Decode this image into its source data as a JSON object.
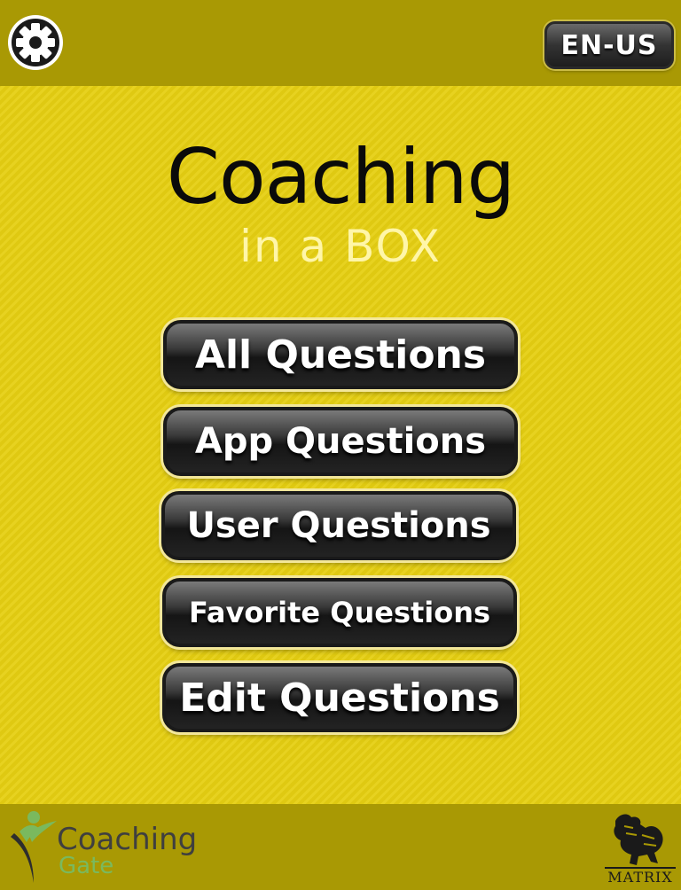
{
  "header": {
    "settings_icon": "gear-icon",
    "language_label": "EN-US"
  },
  "title": {
    "main": "Coaching",
    "sub": "in a BOX"
  },
  "menu": {
    "items": [
      {
        "label": "All Questions"
      },
      {
        "label": "App Questions"
      },
      {
        "label": "User Questions"
      },
      {
        "label": "Favorite Questions"
      },
      {
        "label": "Edit Questions"
      }
    ]
  },
  "footer": {
    "coaching_gate": {
      "line1": "Coaching",
      "line2": "Gate"
    },
    "matrix": {
      "label": "MATRIX"
    }
  },
  "colors": {
    "background": "#e6cf12",
    "bar": "#a99904",
    "title_main": "#0a0a0a",
    "title_sub": "#fff6a8",
    "button": "#232323",
    "coaching_gate_green": "#7ab95e"
  }
}
